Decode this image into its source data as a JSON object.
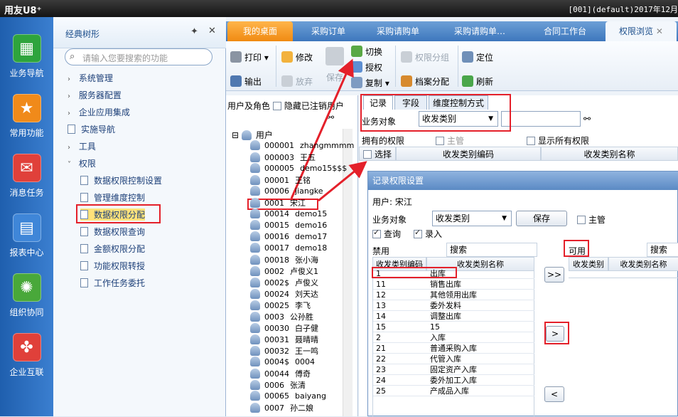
{
  "titlebar": {
    "brand": "用友U8⁺",
    "right_text": "[001](default)2017年12月"
  },
  "nav": [
    {
      "label": "业务导航",
      "icon": "grid-icon",
      "color": "#2ea43d"
    },
    {
      "label": "常用功能",
      "icon": "star-icon",
      "color": "#f08a1a"
    },
    {
      "label": "消息任务",
      "icon": "mail-icon",
      "color": "#e0403a"
    },
    {
      "label": "报表中心",
      "icon": "report-icon",
      "color": "#3f86d8"
    },
    {
      "label": "组织协同",
      "icon": "org-icon",
      "color": "#49a83a"
    },
    {
      "label": "企业互联",
      "icon": "link-icon",
      "color": "#e0403a"
    }
  ],
  "tree": {
    "title": "经典树形",
    "search_placeholder": "请输入您要搜索的功能",
    "items": [
      "系统管理",
      "服务器配置",
      "企业应用集成",
      "实施导航",
      "工具",
      "权限"
    ],
    "sub": [
      "数据权限控制设置",
      "管理维度控制",
      "数据权限分配",
      "数据权限查询",
      "金额权限分配",
      "功能权限转授",
      "工作任务委托"
    ]
  },
  "tabs": [
    "我的桌面",
    "采购订单",
    "采购请购单",
    "采购请购单…",
    "合同工作台",
    "权限浏览"
  ],
  "toolbar": {
    "print": "打印",
    "modify": "修改",
    "save": "保存",
    "switch": "切换",
    "authorize": "授权",
    "perm_group": "权限分组",
    "locate": "定位",
    "output": "输出",
    "abandon": "放弃",
    "copy": "复制",
    "archive": "档案分配",
    "refresh": "刷新"
  },
  "users": {
    "header": "用户及角色",
    "hide_logout": "隐藏已注销用户",
    "root": "用户",
    "list": [
      [
        "000001",
        "zhangmmmm"
      ],
      [
        "000003",
        "王五"
      ],
      [
        "000005",
        "demo15$$$"
      ],
      [
        "00001",
        "王铭"
      ],
      [
        "00006",
        "jiangke"
      ],
      [
        "0001",
        "宋江"
      ],
      [
        "00014",
        "demo15"
      ],
      [
        "00015",
        "demo16"
      ],
      [
        "00016",
        "demo17"
      ],
      [
        "00017",
        "demo18"
      ],
      [
        "00018",
        "张小海"
      ],
      [
        "0002",
        "卢俊义1"
      ],
      [
        "0002$",
        "卢俊义"
      ],
      [
        "00024",
        "刘天达"
      ],
      [
        "00025",
        "李飞"
      ],
      [
        "0003",
        "公孙胜"
      ],
      [
        "00030",
        "白子健"
      ],
      [
        "00031",
        "聂晴晴"
      ],
      [
        "00032",
        "王一鸣"
      ],
      [
        "0004$",
        "0004"
      ],
      [
        "00044",
        "傅奇"
      ],
      [
        "0006",
        "张清"
      ],
      [
        "00065",
        "baiyang"
      ],
      [
        "0007",
        "孙二娘"
      ]
    ]
  },
  "rights": {
    "tabs": [
      "记录",
      "字段",
      "维度控制方式"
    ],
    "biz_label": "业务对象",
    "biz_value": "收发类别",
    "owned": "拥有的权限",
    "master": "主管",
    "show_all": "显示所有权限",
    "select": "选择",
    "col_code": "收发类别编码",
    "col_name": "收发类别名称"
  },
  "dialog": {
    "title": "记录权限设置",
    "user": "用户: 宋江",
    "biz_label": "业务对象",
    "biz_value": "收发类别",
    "save": "保存",
    "master": "主管",
    "query": "查询",
    "entry": "录入",
    "forbid": "禁用",
    "search": "搜索",
    "avail": "可用",
    "search2": "搜索",
    "col_code": "收发类别编码",
    "col_name": "收发类别名称",
    "col_code2": "收发类别编",
    "col_name2": "收发类别名称",
    "rows": [
      [
        "1",
        "出库"
      ],
      [
        "11",
        "销售出库"
      ],
      [
        "12",
        "其他领用出库"
      ],
      [
        "13",
        "委外发料"
      ],
      [
        "14",
        "调整出库"
      ],
      [
        "15",
        "15"
      ],
      [
        "2",
        "入库"
      ],
      [
        "21",
        "普通采购入库"
      ],
      [
        "22",
        "代管入库"
      ],
      [
        "23",
        "固定资产入库"
      ],
      [
        "24",
        "委外加工入库"
      ],
      [
        "25",
        "产成品入库"
      ]
    ],
    "btn_all": ">>",
    "btn_one": ">",
    "btn_back": "<"
  }
}
